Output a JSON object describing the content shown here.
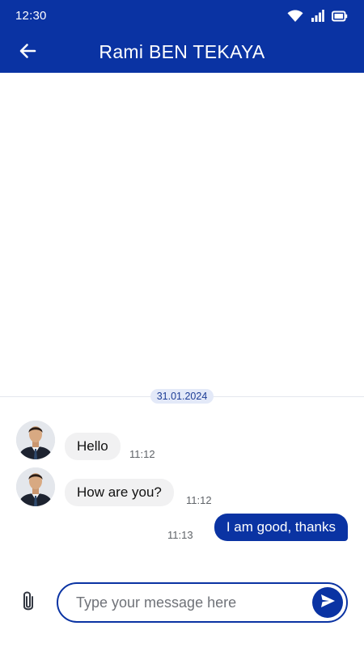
{
  "status_bar": {
    "time": "12:30",
    "icons": [
      "wifi-icon",
      "signal-icon",
      "battery-icon"
    ]
  },
  "header": {
    "back_icon": "arrow-left-icon",
    "title": "Rami BEN TEKAYA"
  },
  "conversation": {
    "date_label": "31.01.2024",
    "messages": [
      {
        "direction": "incoming",
        "text": "Hello",
        "time": "11:12"
      },
      {
        "direction": "incoming",
        "text": "How are you?",
        "time": "11:12"
      },
      {
        "direction": "outgoing",
        "text": "I am good, thanks",
        "time": "11:13"
      }
    ]
  },
  "composer": {
    "attach_icon": "paperclip-icon",
    "placeholder": "Type your message here",
    "value": "",
    "send_icon": "send-icon"
  },
  "colors": {
    "primary": "#0a33a3",
    "incoming_bubble": "#f1f1f2",
    "date_chip": "#e3e9f8"
  }
}
